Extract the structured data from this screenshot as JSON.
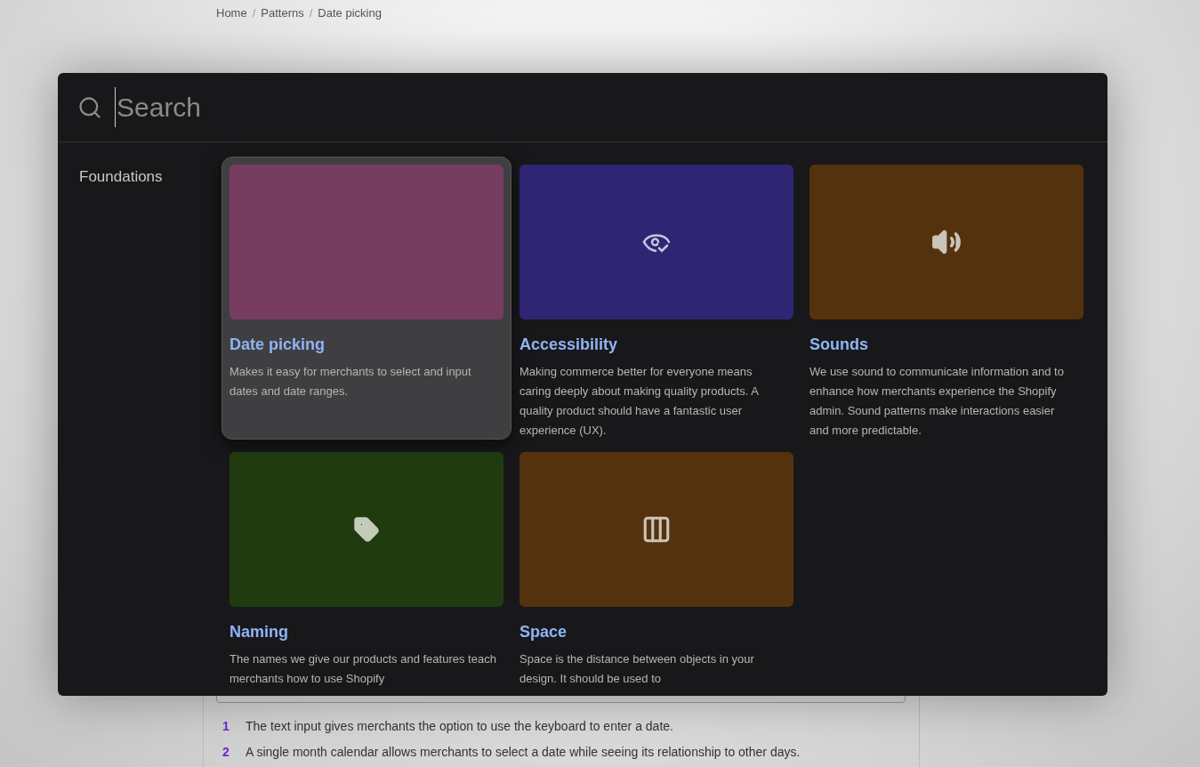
{
  "breadcrumb": [
    {
      "label": "Home"
    },
    {
      "separator": "/",
      "label": "Patterns"
    },
    {
      "separator": "/",
      "label": "Date picking"
    }
  ],
  "steps": [
    {
      "number": "1",
      "text": "The text input gives merchants the option to use the keyboard to enter a date."
    },
    {
      "number": "2",
      "text": "A single month calendar allows merchants to select a date while seeing its relationship to other days."
    }
  ],
  "search": {
    "placeholder": "Search"
  },
  "sidebar": {
    "items": [
      {
        "label": "Foundations"
      }
    ]
  },
  "cards": [
    {
      "title": "Date picking",
      "description": "Makes it easy for merchants to select and input dates and date ranges.",
      "color": "#773d61",
      "kind": "plain",
      "selected": true
    },
    {
      "title": "Accessibility",
      "description": "Making commerce better for everyone means caring deeply about making quality products. A quality product should have a fantastic user experience (UX).",
      "color": "#2e2574",
      "kind": "eye",
      "selected": false
    },
    {
      "title": "Sounds",
      "description": "We use sound to communicate information and to enhance how merchants experience the Shopify admin. Sound patterns make interactions easier and more predictable.",
      "color": "#55320e",
      "kind": "sound",
      "selected": false
    },
    {
      "title": "Naming",
      "description": "The names we give our products and features teach merchants how to use Shopify",
      "color": "#1f3b0f",
      "kind": "tag",
      "selected": false
    },
    {
      "title": "Space",
      "description": "Space is the distance between objects in your design. It should be used to",
      "color": "#55320e",
      "kind": "columns",
      "selected": false
    }
  ]
}
